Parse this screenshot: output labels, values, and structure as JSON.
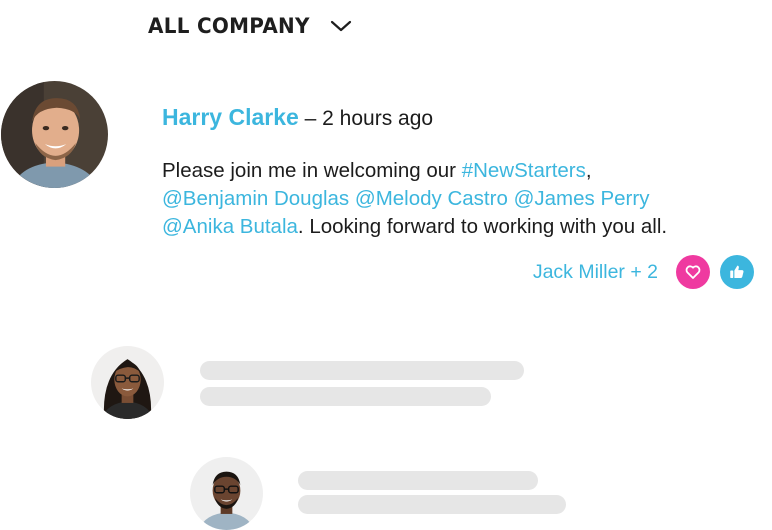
{
  "feed": {
    "title": "ALL COMPANY"
  },
  "post": {
    "author": "Harry Clarke",
    "separator": "–",
    "time": "2 hours ago",
    "body_prefix": "Please join me in welcoming our ",
    "hashtag": "#NewStarters",
    "after_hashtag": ",",
    "mentions": [
      "@Benjamin Douglas",
      "@Melody Castro",
      "@James Perry",
      "@Anika Butala"
    ],
    "body_suffix": ". Looking forward to working with you all.",
    "reacted_by": "Jack Miller + 2"
  },
  "icons": {
    "dropdown": "chevron-down-icon",
    "love": "heart-icon",
    "like": "thumbs-up-icon"
  },
  "colors": {
    "accent_blue": "#3cb6de",
    "love_pink": "#ef3aa0",
    "skeleton_gray": "#e6e6e6",
    "text_dark": "#1c1c1c"
  }
}
